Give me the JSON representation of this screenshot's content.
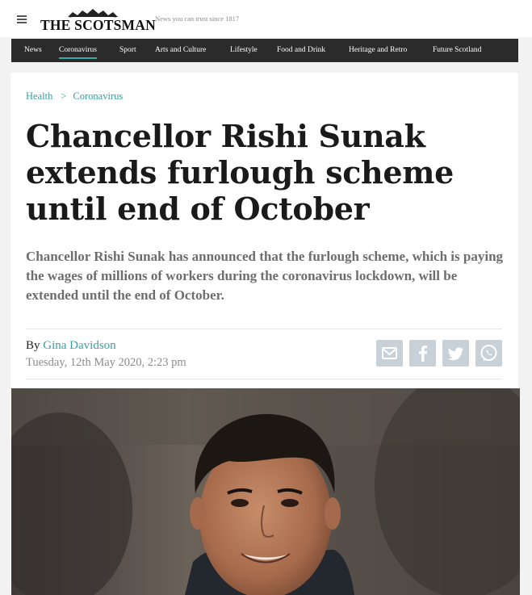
{
  "header": {
    "logo_text": "THE SCOTSMAN",
    "tagline": "News you can trust since 1817"
  },
  "nav": {
    "items": [
      {
        "label": "News"
      },
      {
        "label": "Coronavirus",
        "active": true
      },
      {
        "label": "Sport"
      },
      {
        "label": "Arts and Culture"
      },
      {
        "label": "Lifestyle"
      },
      {
        "label": "Food and Drink"
      },
      {
        "label": "Heritage and Retro"
      },
      {
        "label": "Future Scotland"
      }
    ]
  },
  "breadcrumb": {
    "items": [
      "Health",
      "Coronavirus"
    ],
    "separator": ">"
  },
  "article": {
    "headline": "Chancellor Rishi Sunak extends furlough scheme until end of October",
    "standfirst": "Chancellor Rishi Sunak has announced that the furlough scheme, which is paying the wages of millions of workers during the coronavirus lockdown, will be extended until the end of October.",
    "byline_prefix": "By",
    "author": "Gina Davidson",
    "date": "Tuesday, 12th May 2020, 2:23 pm"
  },
  "share": {
    "buttons": [
      {
        "icon": "email-icon"
      },
      {
        "icon": "facebook-icon"
      },
      {
        "icon": "twitter-icon"
      },
      {
        "icon": "whatsapp-icon"
      }
    ]
  },
  "colors": {
    "accent": "#3a9ea0",
    "nav_background": "#2b2b2b",
    "share_button": "#c9d1d8"
  }
}
